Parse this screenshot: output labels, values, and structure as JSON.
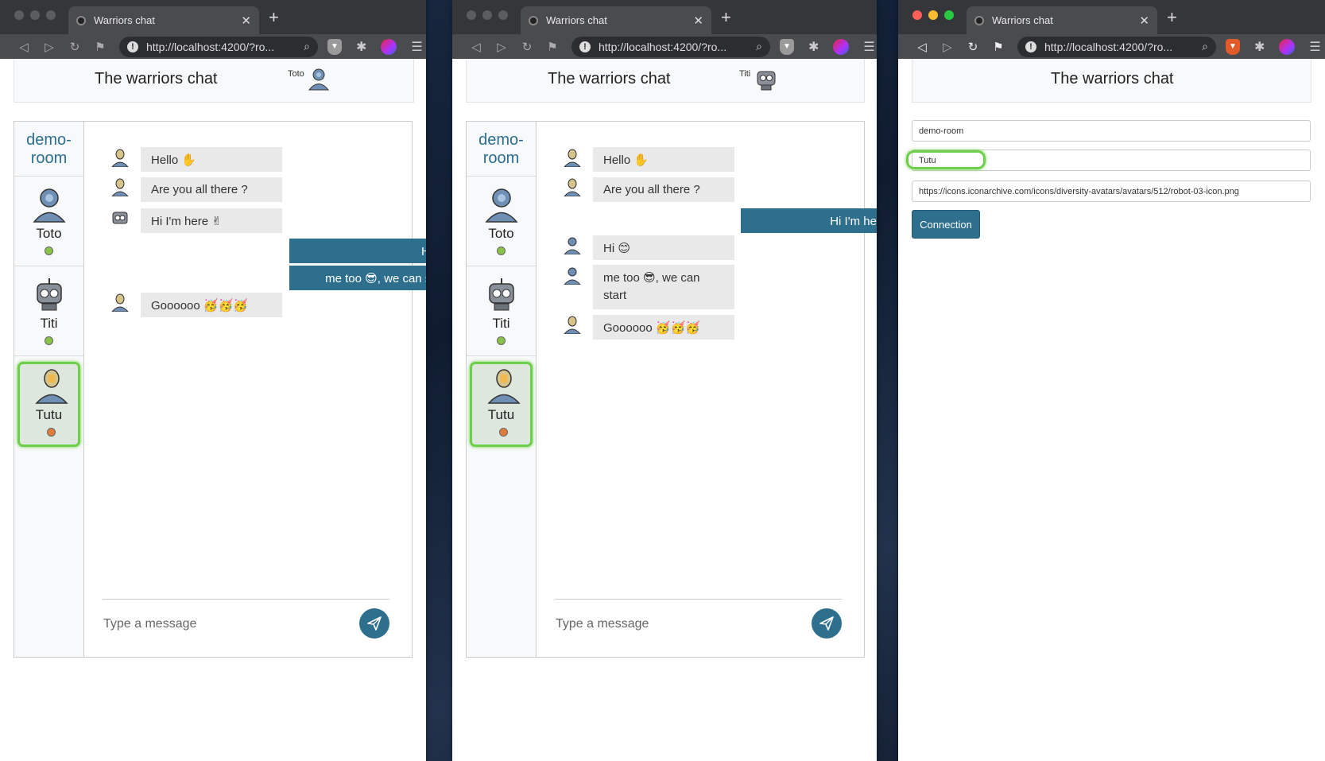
{
  "browser": {
    "tab_title": "Warriors chat",
    "url": "http://localhost:4200/?ro..."
  },
  "app": {
    "title": "The warriors chat"
  },
  "windows": [
    {
      "user_label": "Toto",
      "room": "demo-room",
      "members": [
        {
          "name": "Toto",
          "status": "online"
        },
        {
          "name": "Titi",
          "status": "online"
        },
        {
          "name": "Tutu",
          "status": "away"
        }
      ],
      "messages": [
        {
          "dir": "in",
          "avatar": "tutu-avatar",
          "text": "Hello ✋"
        },
        {
          "dir": "in",
          "avatar": "tutu-avatar",
          "text": "Are you all there ?"
        },
        {
          "dir": "in",
          "avatar": "titi-avatar",
          "text": "Hi I'm here ✌"
        },
        {
          "dir": "out",
          "text": "Hi 😊"
        },
        {
          "dir": "out",
          "text": "me too 😎, we can start"
        },
        {
          "dir": "in",
          "avatar": "tutu-avatar",
          "text": "Goooooo 🥳🥳🥳"
        }
      ],
      "input_placeholder": "Type a message"
    },
    {
      "user_label": "Titi",
      "room": "demo-room",
      "members": [
        {
          "name": "Toto",
          "status": "online"
        },
        {
          "name": "Titi",
          "status": "online"
        },
        {
          "name": "Tutu",
          "status": "away"
        }
      ],
      "messages": [
        {
          "dir": "in",
          "avatar": "tutu-avatar",
          "text": "Hello ✋"
        },
        {
          "dir": "in",
          "avatar": "tutu-avatar",
          "text": "Are you all there ?"
        },
        {
          "dir": "out",
          "text": "Hi I'm here ✌"
        },
        {
          "dir": "in",
          "avatar": "toto-avatar",
          "text": "Hi 😊"
        },
        {
          "dir": "in",
          "avatar": "toto-avatar",
          "text": "me too 😎, we can start"
        },
        {
          "dir": "in",
          "avatar": "tutu-avatar",
          "text": "Goooooo 🥳🥳🥳"
        }
      ],
      "input_placeholder": "Type a message"
    },
    {
      "login": {
        "room_value": "demo-room",
        "name_value": "Tutu",
        "avatar_url_value": "https://icons.iconarchive.com/icons/diversity-avatars/avatars/512/robot-03-icon.png",
        "connect_label": "Connection"
      }
    }
  ],
  "colors": {
    "accent": "#2e6f8d",
    "online": "#8bc34a",
    "away": "#e07b3c",
    "highlight": "#6ecf4a"
  },
  "icons": [
    "info-icon",
    "zoom-icon",
    "brave-shield-icon",
    "extensions-icon",
    "profile-icon",
    "menu-icon",
    "send-icon",
    "robot-avatar-icon"
  ]
}
